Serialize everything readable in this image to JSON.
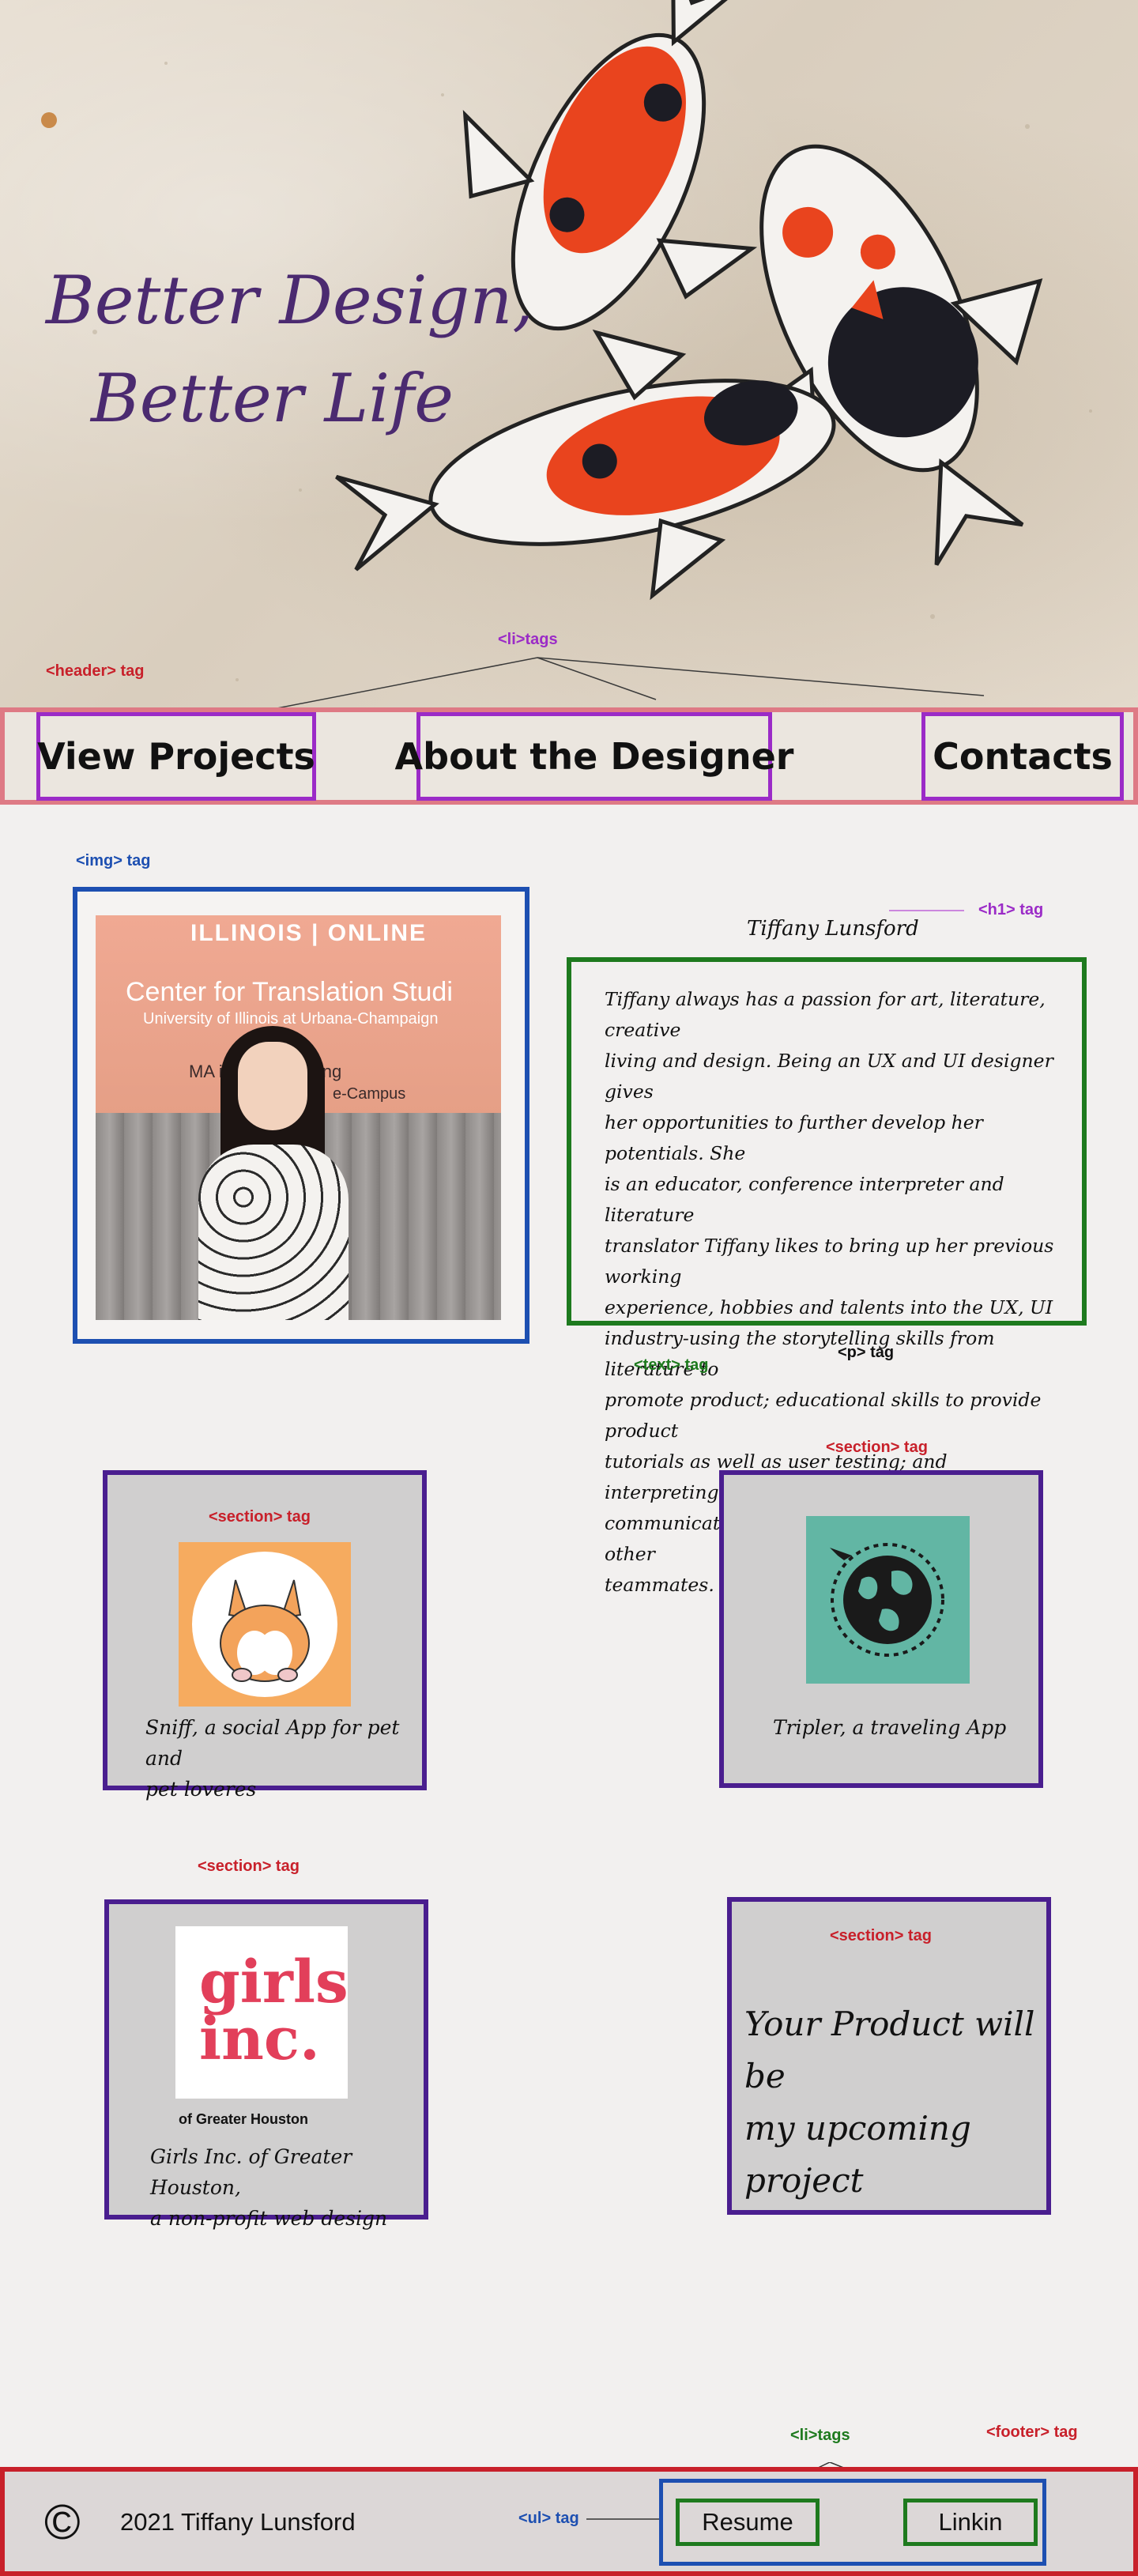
{
  "hero": {
    "title_line1": "Better Design,",
    "title_line2": "Better Life"
  },
  "annotations": {
    "header_tag": "<header> tag",
    "li_tags": "<li>tags",
    "img_tag": "<img> tag",
    "h1_tag": "<h1> tag",
    "text_tag": "<text> tag",
    "p_tag": "<p> tag",
    "section_tag": "<section> tag",
    "footer_li_tags": "<li>tags",
    "footer_tag": "<footer> tag",
    "ul_tag": "<ul> tag"
  },
  "nav": {
    "items": [
      {
        "label": "View Projects"
      },
      {
        "label": "About the Designer"
      },
      {
        "label": "Contacts"
      }
    ]
  },
  "about": {
    "photo_banner": {
      "line_top": "ILLINOIS | ONLINE",
      "line1": "Center for Translation Studi",
      "line2": "University of Illinois at Urbana-Champaign",
      "line3": "MA in     & Interpreting",
      "line4": "e-Campus"
    },
    "name": "Tiffany Lunsford",
    "bio_lines": [
      "Tiffany always has a passion for art, literature, creative",
      "living and design. Being an UX and UI designer gives",
      "her opportunities to further develop her potentials. She",
      "is an educator, conference interpreter and literature",
      "translator Tiffany likes to bring up her previous working",
      "experience, hobbies and talents into the UX, UI",
      "industry-using the storytelling skills from literature to",
      "promote product; educational skills to provide product",
      "tutorials as well as user testing; and interpreting skills to",
      "communicate with clients, stockholders and other",
      "teammates."
    ]
  },
  "projects": [
    {
      "caption_line1": "Sniff, a social App for pet and",
      "caption_line2": "pet loveres"
    },
    {
      "caption_line1": "Tripler, a traveling App"
    },
    {
      "logo_text_1": "girls",
      "logo_text_2": "inc.",
      "logo_sub": "of Greater Houston",
      "caption_line1": "Girls Inc. of Greater Houston,",
      "caption_line2": "a non-profit web design"
    },
    {
      "caption_line1": "Your Product will be",
      "caption_line2": "my upcoming project"
    }
  ],
  "footer": {
    "copyright_symbol": "©",
    "copyright_text": "2021 Tiffany Lunsford",
    "links": [
      {
        "label": "Resume"
      },
      {
        "label": "Linkin"
      }
    ]
  },
  "colors": {
    "header_border": "#de7a85",
    "nav_item_border": "#9b2bc7",
    "img_border": "#1d4fb1",
    "text_border": "#1e7a1e",
    "section_border": "#4a1e8f",
    "footer_border": "#c8202a",
    "card_bg": "#d0cfcf",
    "title_color": "#4b2a70"
  }
}
